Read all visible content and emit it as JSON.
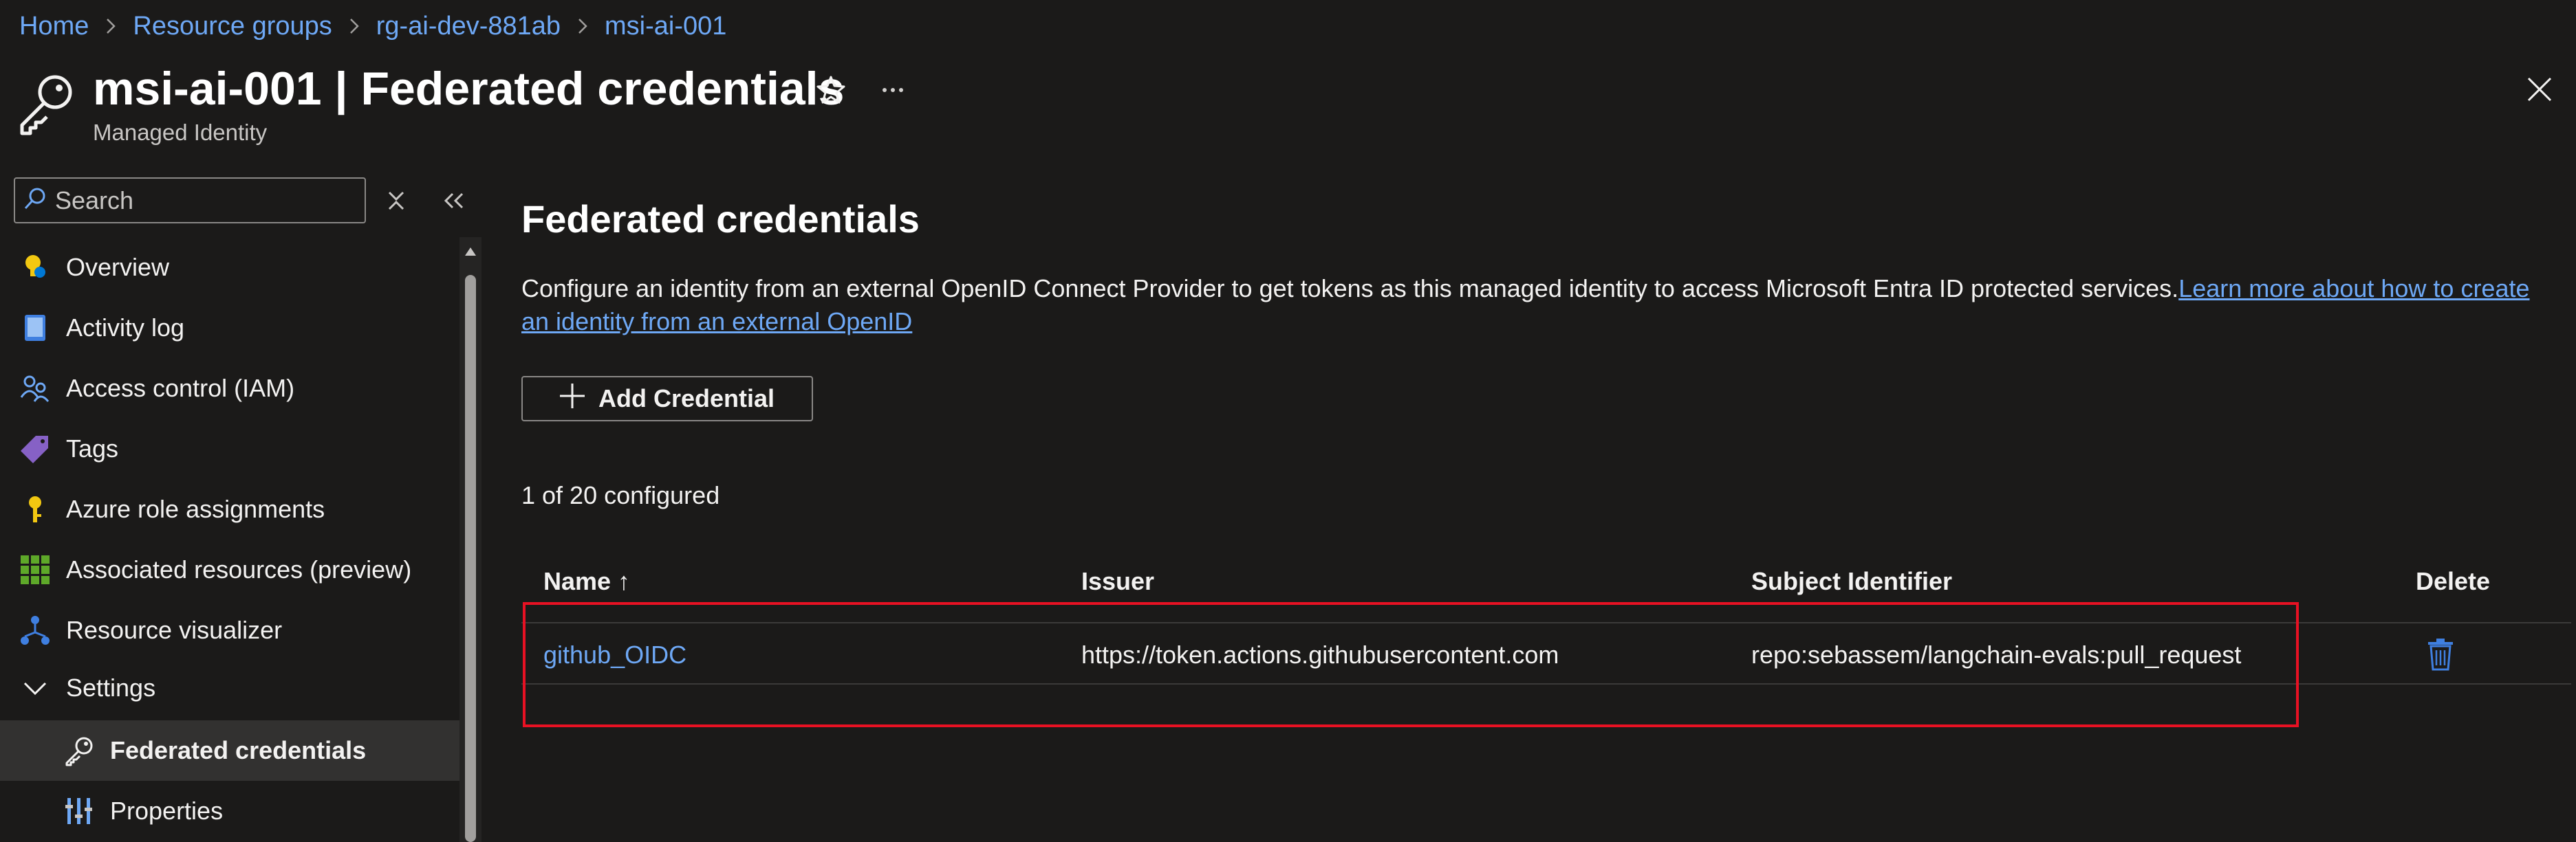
{
  "breadcrumb": {
    "items": [
      "Home",
      "Resource groups",
      "rg-ai-dev-881ab",
      "msi-ai-001"
    ]
  },
  "header": {
    "title": "msi-ai-001 | Federated credentials",
    "subtitle": "Managed Identity",
    "icon": "key-icon"
  },
  "search": {
    "placeholder": "Search"
  },
  "sidebar": {
    "items": [
      {
        "label": "Overview",
        "icon": "lightbulb-icon"
      },
      {
        "label": "Activity log",
        "icon": "book-icon"
      },
      {
        "label": "Access control (IAM)",
        "icon": "people-icon"
      },
      {
        "label": "Tags",
        "icon": "tag-icon"
      },
      {
        "label": "Azure role assignments",
        "icon": "key-icon"
      },
      {
        "label": "Associated resources (preview)",
        "icon": "grid-icon"
      },
      {
        "label": "Resource visualizer",
        "icon": "hierarchy-icon"
      },
      {
        "label": "Settings",
        "icon": "chevron-down-icon"
      },
      {
        "label": "Federated credentials",
        "icon": "key-icon",
        "selected": true
      },
      {
        "label": "Properties",
        "icon": "bars-icon"
      }
    ]
  },
  "main": {
    "title": "Federated credentials",
    "description": "Configure an identity from an external OpenID Connect Provider to get tokens as this managed identity to access Microsoft Entra ID protected services.",
    "learn_more": "Learn more about how to create an identity from an external OpenID",
    "add_button": "Add Credential",
    "count": "1 of 20 configured"
  },
  "table": {
    "columns": [
      "Name ↑",
      "Issuer",
      "Subject Identifier",
      "Delete"
    ],
    "rows": [
      {
        "name": "github_OIDC",
        "issuer": "https://token.actions.githubusercontent.com",
        "subject": "repo:sebassem/langchain-evals:pull_request"
      }
    ]
  },
  "colors": {
    "background": "#1b1a19",
    "link": "#6ea8f5",
    "highlight": "#e81123",
    "selected": "#323130"
  }
}
